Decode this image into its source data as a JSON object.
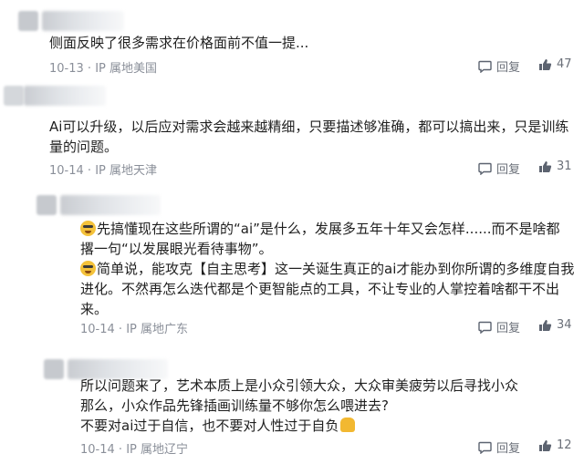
{
  "comments": [
    {
      "lines": [
        "侧面反映了很多需求在价格面前不值一提..."
      ],
      "date": "10-13",
      "ip": "IP 属地美国",
      "reply_label": "回复",
      "likes": "47"
    },
    {
      "lines": [
        "Ai可以升级，以后应对需求会越来越精细，只要描述够准确，都可以搞出来，只是训练",
        "量的问题。"
      ],
      "date": "10-14",
      "ip": "IP 属地天津",
      "reply_label": "回复",
      "likes": "31"
    },
    {
      "lines": [
        "先搞懂现在这些所谓的“ai”是什么，发展多五年十年又会怎样......而不是啥都",
        "撂一句“以发展眼光看待事物”。",
        "简单说，能攻克【自主思考】这一关诞生真正的ai才能办到你所谓的多维度自我",
        "进化。不然再怎么迭代都是个更智能点的工具，不让专业的人掌控着啥都干不出",
        "来。"
      ],
      "date": "10-14",
      "ip": "IP 属地广东",
      "reply_label": "回复",
      "likes": "34"
    },
    {
      "lines": [
        "所以问题来了，艺术本质上是小众引领大众，大众审美疲劳以后寻找小众",
        "那么，小众作品先锋插画训练量不够你怎么喂进去?",
        "不要对ai过于自信，也不要对人性过于自负"
      ],
      "date": "10-14",
      "ip": "IP 属地辽宁",
      "reply_label": "回复",
      "likes": "12"
    }
  ],
  "icons": {
    "reply": "reply-bubble-icon",
    "like": "thumbs-up-icon",
    "smile": "smile-emoji-icon",
    "pray": "praying-hands-emoji-icon"
  }
}
